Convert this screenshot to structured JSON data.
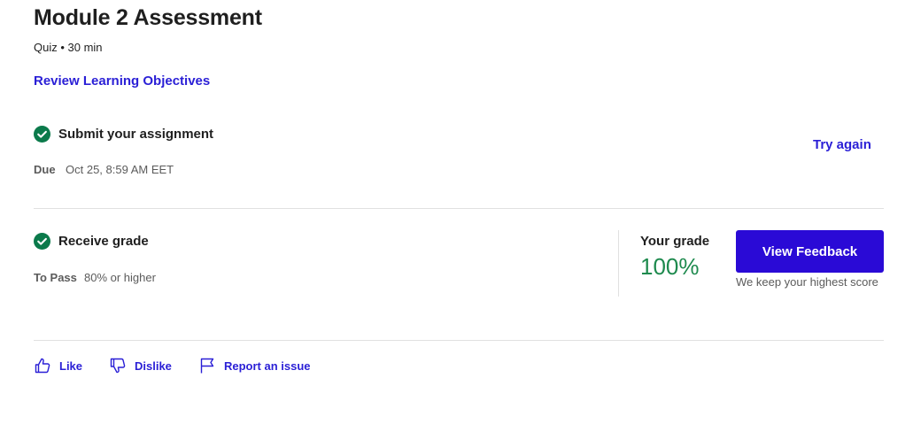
{
  "header": {
    "title": "Module 2 Assessment",
    "meta": "Quiz • 30 min",
    "review_link": "Review Learning Objectives"
  },
  "submit": {
    "title": "Submit your assignment",
    "due_label": "Due",
    "due_value": "Oct 25, 8:59 AM EET",
    "try_again": "Try again"
  },
  "grade": {
    "title": "Receive grade",
    "pass_label": "To Pass",
    "pass_value": "80% or higher",
    "your_grade_label": "Your grade",
    "your_grade_value": "100%",
    "view_feedback": "View Feedback",
    "note": "We keep your highest score"
  },
  "feedback": {
    "like": "Like",
    "dislike": "Dislike",
    "report": "Report an issue"
  },
  "icons": {
    "check": "check-circle-icon",
    "like": "thumbs-up-icon",
    "dislike": "thumbs-down-icon",
    "report": "flag-icon"
  },
  "colors": {
    "accent": "#2a0ad6",
    "link": "#2a1fd6",
    "success": "#1e8a4e",
    "check": "#0b7a4b"
  }
}
